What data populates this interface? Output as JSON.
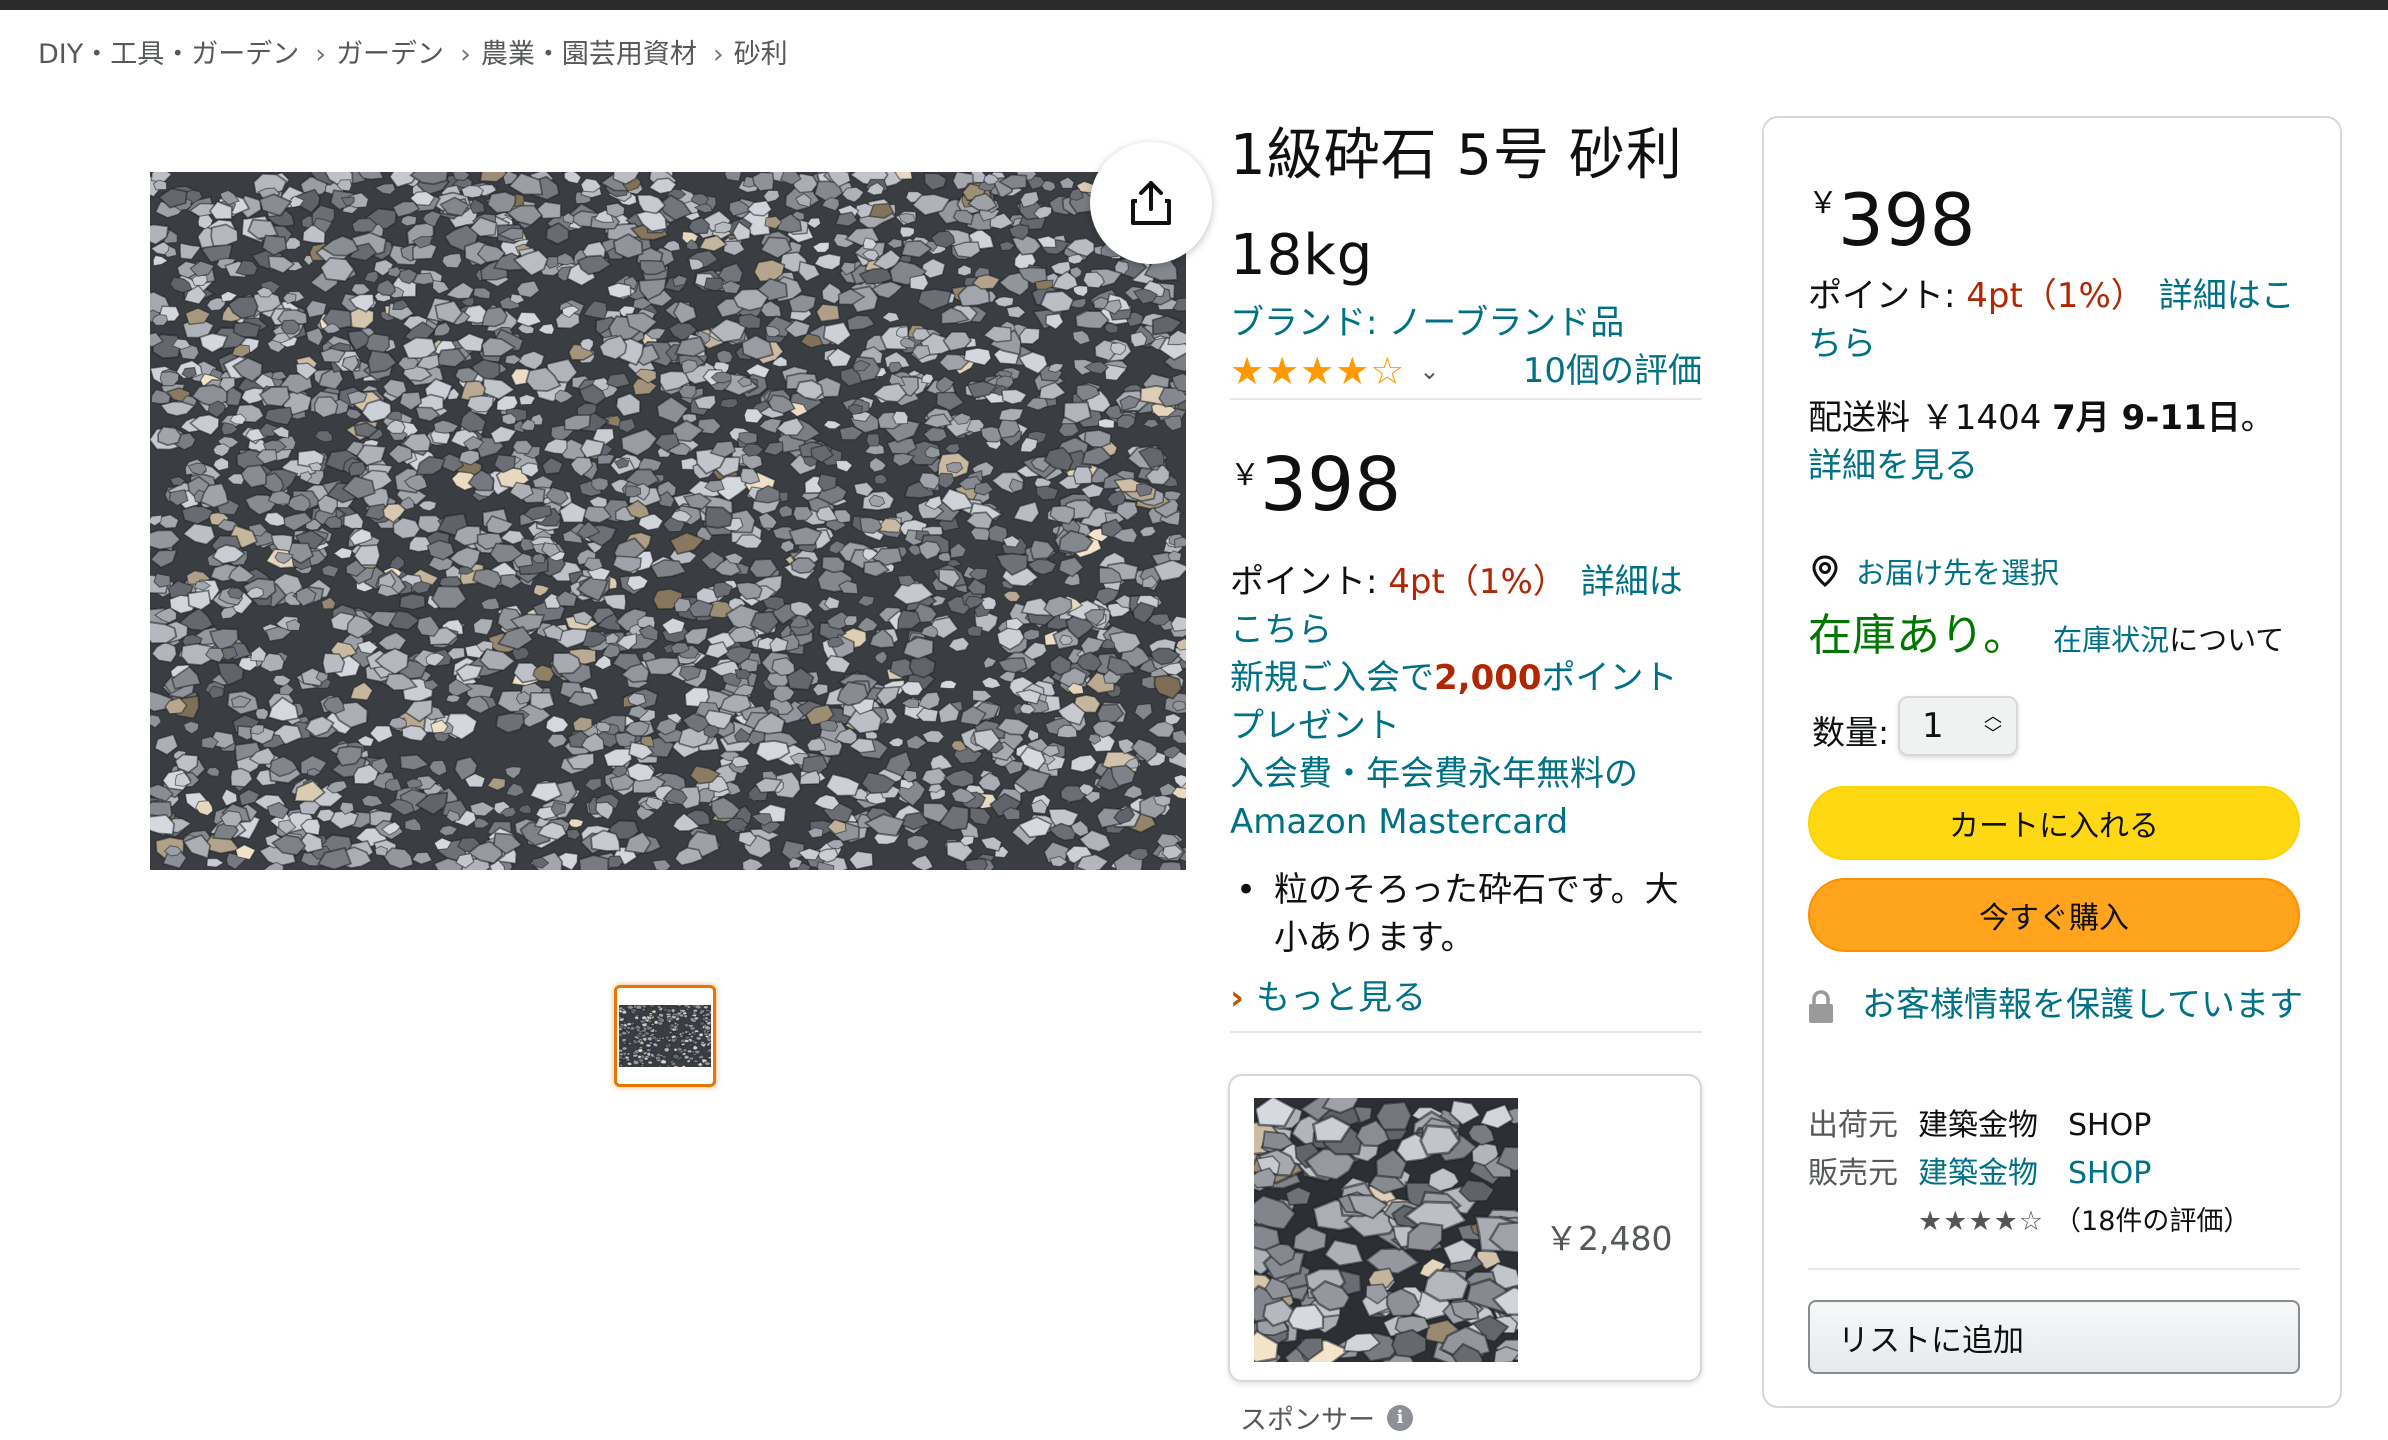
{
  "breadcrumb": [
    "DIY・工具・ガーデン",
    "ガーデン",
    "農業・園芸用資材",
    "砂利"
  ],
  "product": {
    "title_line1": "1級砕石 5号 砂利",
    "title_line2": "18kg",
    "brand": "ブランド: ノーブランド品",
    "stars_display": "★★★★☆",
    "rating": 4.0,
    "reviews": "10個の評価",
    "currency": "￥",
    "price": "398",
    "points_label": "ポイント: ",
    "points_value": "4pt（1%）",
    "points_link": "詳細はこちら",
    "promo_pre": "新規ご入会で",
    "promo_points": "2,000",
    "promo_post": "ポイントプレゼント",
    "promo_line2": "入会費・年会費永年無料の",
    "promo_line3": "Amazon Mastercard",
    "bullet": "粒のそろった砕石です。大小あります。",
    "more": "もっと見る"
  },
  "sponsored": {
    "price": "￥2,480",
    "label": "スポンサー",
    "info": "i"
  },
  "buybox": {
    "currency": "￥",
    "price": "398",
    "points_label": "ポイント: ",
    "points_value": "4pt（1%）",
    "points_link": "詳細はこちら",
    "shipping_pre": "配送料 ￥1404 ",
    "shipping_date": "7月 9-11日",
    "shipping_post": "。",
    "details": "詳細を見る",
    "deliver_to": "お届け先を選択",
    "in_stock": "在庫あり。",
    "stock_link": "在庫状況",
    "stock_about": "について",
    "qty_label": "数量:",
    "qty_value": "1",
    "add_to_cart": "カートに入れる",
    "buy_now": "今すぐ購入",
    "secure": "お客様情報を保護しています",
    "ships_from_label": "出荷元",
    "ships_from": "建築金物　SHOP",
    "sold_by_label": "販売元",
    "sold_by": "建築金物　SHOP",
    "seller_stars": "★★★★☆",
    "seller_reviews": "（18件の評価）",
    "add_to_list": "リストに追加"
  },
  "colors": {
    "link": "#007185",
    "price_red": "#b12704",
    "in_stock": "#007600",
    "cart_button": "#ffd814",
    "buy_button": "#ffa41c",
    "star": "#ff9900"
  }
}
